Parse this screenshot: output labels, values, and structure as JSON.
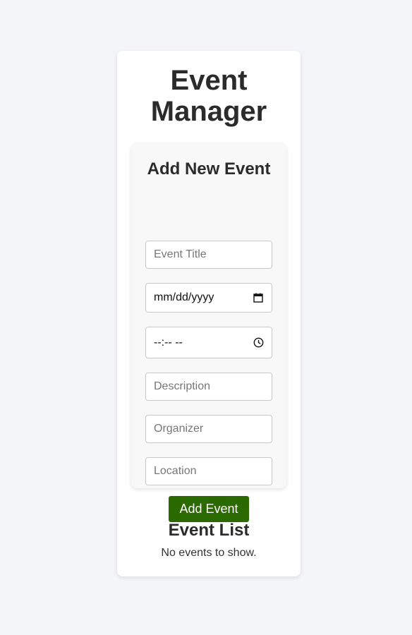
{
  "app": {
    "title": "Event Manager"
  },
  "form": {
    "title": "Add New Event",
    "event_title": {
      "placeholder": "Event Title",
      "value": ""
    },
    "date": {
      "value": "mm/dd/yyyy",
      "icon": "calendar-icon"
    },
    "time": {
      "value": "--:-- --",
      "icon": "clock-icon"
    },
    "description": {
      "placeholder": "Description",
      "value": ""
    },
    "organizer": {
      "placeholder": "Organizer",
      "value": ""
    },
    "location": {
      "placeholder": "Location",
      "value": ""
    },
    "submit_label": "Add Event"
  },
  "event_list": {
    "title": "Event List",
    "empty_message": "No events to show.",
    "items": []
  },
  "colors": {
    "background": "#f4f5f9",
    "card": "#ffffff",
    "panel": "#f8f8f8",
    "button": "#2a6a00",
    "text": "#2b2b2b"
  }
}
